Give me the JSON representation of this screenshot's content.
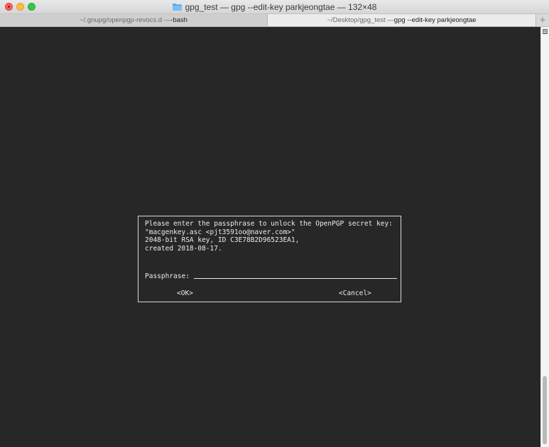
{
  "window": {
    "title": "gpg_test — gpg --edit-key parkjeongtae — 132×48",
    "folder_icon": "folder-icon"
  },
  "tabs": [
    {
      "prefix": "~/.gnupg/openpgp-revocs.d — ",
      "command": "-bash",
      "active": false
    },
    {
      "prefix": "~/Desktop/gpg_test — ",
      "command": "gpg --edit-key parkjeongtae",
      "active": true
    }
  ],
  "new_tab_label": "+",
  "colors": {
    "terminal_bg": "#272727",
    "terminal_fg": "#ececec"
  },
  "dialog": {
    "lines": [
      "Please enter the passphrase to unlock the OpenPGP secret key:",
      "\"macgenkey.asc <pjt3591oo@naver.com>\"",
      "2048-bit RSA key, ID C3E78B2D96523EA1,",
      "created 2018-08-17."
    ],
    "passphrase_label": "Passphrase:",
    "passphrase_value": "",
    "ok_label": "<OK>",
    "cancel_label": "<Cancel>"
  }
}
